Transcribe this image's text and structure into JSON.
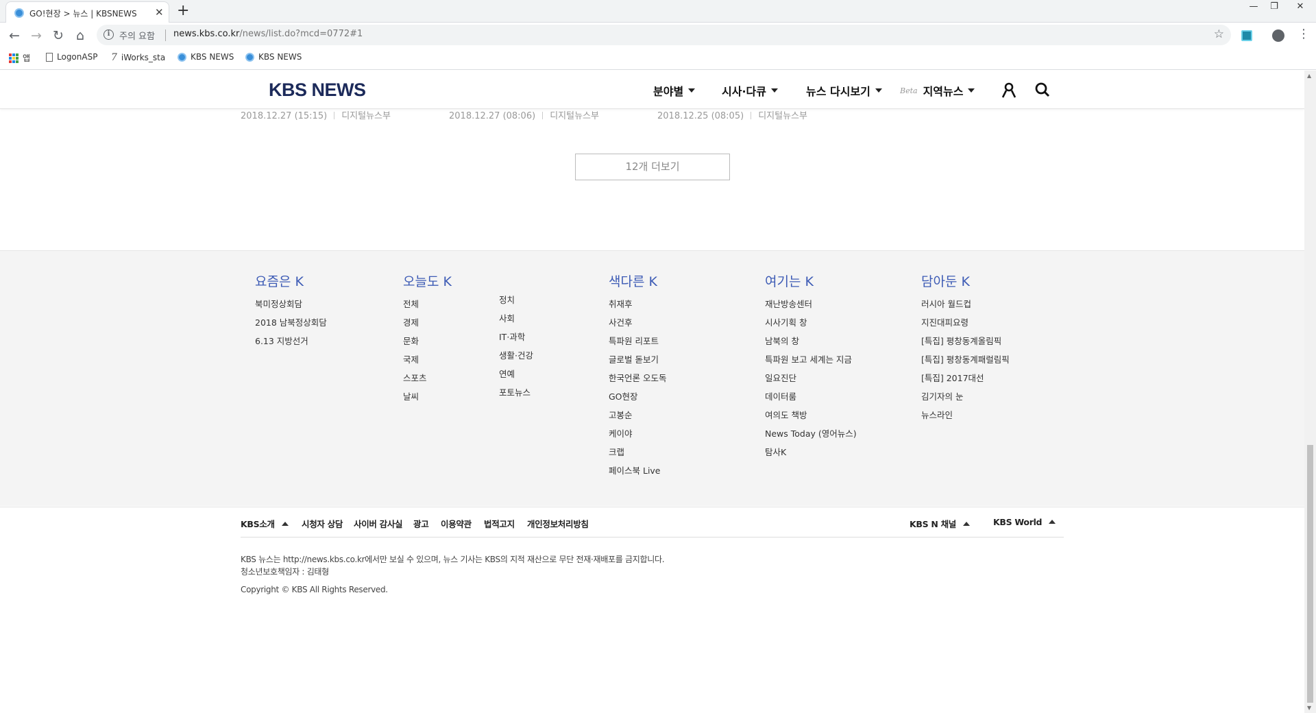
{
  "browser": {
    "tab_title": "GO!현장 > 뉴스 | KBSNEWS",
    "tab_close": "✕",
    "new_tab": "+",
    "window": {
      "minimize": "—",
      "restore": "❐",
      "close": "✕"
    },
    "nav": {
      "back": "←",
      "forward": "→",
      "reload": "↻",
      "home": "⌂"
    },
    "address": {
      "security_icon": "ⓘ",
      "security_text": "주의 요함",
      "host": "news.kbs.co.kr",
      "path": "/news/list.do?mcd=0772#1",
      "star": "☆"
    },
    "menu": "⋮",
    "bookmarks": [
      {
        "icon": "apps-icon",
        "label": "앱"
      },
      {
        "icon": "page-icon",
        "label": "LogonASP"
      },
      {
        "icon": "iworks-icon",
        "label": "iWorks_sta"
      },
      {
        "icon": "kbs-icon",
        "label": "KBS NEWS"
      },
      {
        "icon": "kbs-icon",
        "label": "KBS NEWS"
      }
    ]
  },
  "header": {
    "logo": "KBS NEWS",
    "nav": [
      {
        "label": "분야별"
      },
      {
        "label": "시사·다큐"
      },
      {
        "label": "뉴스 다시보기"
      },
      {
        "label": "지역뉴스",
        "badge": "Beta"
      }
    ],
    "icons": {
      "user": "user-icon",
      "search": "search-icon"
    }
  },
  "articles_meta": [
    {
      "date": "2018.12.27 (15:15)",
      "dept": "디지털뉴스부"
    },
    {
      "date": "2018.12.27 (08:06)",
      "dept": "디지털뉴스부"
    },
    {
      "date": "2018.12.25 (08:05)",
      "dept": "디지털뉴스부"
    }
  ],
  "more_button": "12개 더보기",
  "sitemap": {
    "col1": {
      "title": "요즘은 K",
      "items": [
        "북미정상회담",
        "2018 남북정상회담",
        "6.13 지방선거"
      ]
    },
    "col2": {
      "title": "오늘도 K",
      "items_a": [
        "전체",
        "경제",
        "문화",
        "국제",
        "스포츠",
        "날씨"
      ],
      "items_b": [
        "정치",
        "사회",
        "IT·과학",
        "생활·건강",
        "연예",
        "포토뉴스"
      ]
    },
    "col3": {
      "title": "색다른 K",
      "items": [
        "취재후",
        "사건후",
        "특파원 리포트",
        "글로벌 돋보기",
        "한국언론 오도독",
        "GO현장",
        "고봉순",
        "케이야",
        "크랩",
        "페이스북 Live"
      ]
    },
    "col4": {
      "title": "여기는 K",
      "items": [
        "재난방송센터",
        "시사기획 창",
        "남북의 창",
        "특파원 보고 세계는 지금",
        "일요진단",
        "데이터룸",
        "여의도 책방",
        "News Today (영어뉴스)",
        "탐사K"
      ]
    },
    "col5": {
      "title": "담아둔 K",
      "items": [
        "러시아 월드컵",
        "지진대피요령",
        "[특집] 평창동계올림픽",
        "[특집] 평창동계패럴림픽",
        "[특집] 2017대선",
        "김기자의 눈",
        "뉴스라인"
      ]
    }
  },
  "footer": {
    "links": [
      "KBS소개",
      "시청자 상담",
      "사이버 감사실",
      "광고",
      "이용약관",
      "법적고지",
      "개인정보처리방침"
    ],
    "channels": [
      "KBS N 채널",
      "KBS World"
    ],
    "notice_line1": "KBS 뉴스는 http://news.kbs.co.kr에서만 보실 수 있으며, 뉴스 기사는 KBS의 지적 재산으로 무단 전재·재배포를 금지합니다.",
    "notice_line2": "청소년보호책임자 : 김태형",
    "copyright": "Copyright © KBS All Rights Reserved."
  },
  "colors": {
    "logo": "#1c2a5a",
    "sitemap_heading": "#3d5bb5",
    "footer_bg": "#f4f4f4",
    "chrome_bg": "#f1f3f4"
  }
}
